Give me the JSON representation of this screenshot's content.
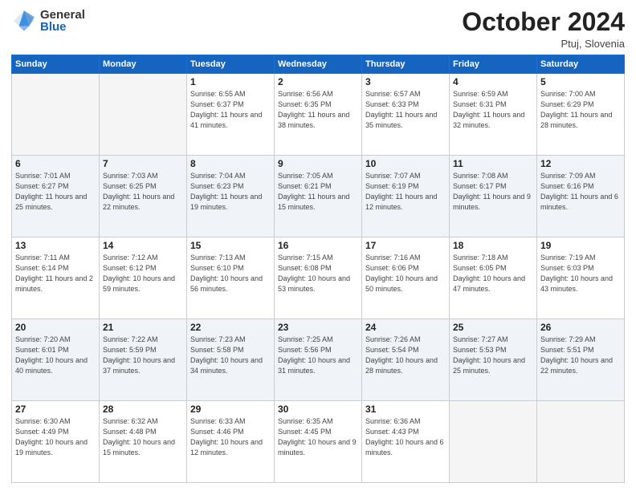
{
  "header": {
    "logo": {
      "general": "General",
      "blue": "Blue"
    },
    "title": "October 2024",
    "location": "Ptuj, Slovenia"
  },
  "weekdays": [
    "Sunday",
    "Monday",
    "Tuesday",
    "Wednesday",
    "Thursday",
    "Friday",
    "Saturday"
  ],
  "weeks": [
    [
      {
        "day": null,
        "info": null
      },
      {
        "day": null,
        "info": null
      },
      {
        "day": "1",
        "info": "Sunrise: 6:55 AM\nSunset: 6:37 PM\nDaylight: 11 hours and 41 minutes."
      },
      {
        "day": "2",
        "info": "Sunrise: 6:56 AM\nSunset: 6:35 PM\nDaylight: 11 hours and 38 minutes."
      },
      {
        "day": "3",
        "info": "Sunrise: 6:57 AM\nSunset: 6:33 PM\nDaylight: 11 hours and 35 minutes."
      },
      {
        "day": "4",
        "info": "Sunrise: 6:59 AM\nSunset: 6:31 PM\nDaylight: 11 hours and 32 minutes."
      },
      {
        "day": "5",
        "info": "Sunrise: 7:00 AM\nSunset: 6:29 PM\nDaylight: 11 hours and 28 minutes."
      }
    ],
    [
      {
        "day": "6",
        "info": "Sunrise: 7:01 AM\nSunset: 6:27 PM\nDaylight: 11 hours and 25 minutes."
      },
      {
        "day": "7",
        "info": "Sunrise: 7:03 AM\nSunset: 6:25 PM\nDaylight: 11 hours and 22 minutes."
      },
      {
        "day": "8",
        "info": "Sunrise: 7:04 AM\nSunset: 6:23 PM\nDaylight: 11 hours and 19 minutes."
      },
      {
        "day": "9",
        "info": "Sunrise: 7:05 AM\nSunset: 6:21 PM\nDaylight: 11 hours and 15 minutes."
      },
      {
        "day": "10",
        "info": "Sunrise: 7:07 AM\nSunset: 6:19 PM\nDaylight: 11 hours and 12 minutes."
      },
      {
        "day": "11",
        "info": "Sunrise: 7:08 AM\nSunset: 6:17 PM\nDaylight: 11 hours and 9 minutes."
      },
      {
        "day": "12",
        "info": "Sunrise: 7:09 AM\nSunset: 6:16 PM\nDaylight: 11 hours and 6 minutes."
      }
    ],
    [
      {
        "day": "13",
        "info": "Sunrise: 7:11 AM\nSunset: 6:14 PM\nDaylight: 11 hours and 2 minutes."
      },
      {
        "day": "14",
        "info": "Sunrise: 7:12 AM\nSunset: 6:12 PM\nDaylight: 10 hours and 59 minutes."
      },
      {
        "day": "15",
        "info": "Sunrise: 7:13 AM\nSunset: 6:10 PM\nDaylight: 10 hours and 56 minutes."
      },
      {
        "day": "16",
        "info": "Sunrise: 7:15 AM\nSunset: 6:08 PM\nDaylight: 10 hours and 53 minutes."
      },
      {
        "day": "17",
        "info": "Sunrise: 7:16 AM\nSunset: 6:06 PM\nDaylight: 10 hours and 50 minutes."
      },
      {
        "day": "18",
        "info": "Sunrise: 7:18 AM\nSunset: 6:05 PM\nDaylight: 10 hours and 47 minutes."
      },
      {
        "day": "19",
        "info": "Sunrise: 7:19 AM\nSunset: 6:03 PM\nDaylight: 10 hours and 43 minutes."
      }
    ],
    [
      {
        "day": "20",
        "info": "Sunrise: 7:20 AM\nSunset: 6:01 PM\nDaylight: 10 hours and 40 minutes."
      },
      {
        "day": "21",
        "info": "Sunrise: 7:22 AM\nSunset: 5:59 PM\nDaylight: 10 hours and 37 minutes."
      },
      {
        "day": "22",
        "info": "Sunrise: 7:23 AM\nSunset: 5:58 PM\nDaylight: 10 hours and 34 minutes."
      },
      {
        "day": "23",
        "info": "Sunrise: 7:25 AM\nSunset: 5:56 PM\nDaylight: 10 hours and 31 minutes."
      },
      {
        "day": "24",
        "info": "Sunrise: 7:26 AM\nSunset: 5:54 PM\nDaylight: 10 hours and 28 minutes."
      },
      {
        "day": "25",
        "info": "Sunrise: 7:27 AM\nSunset: 5:53 PM\nDaylight: 10 hours and 25 minutes."
      },
      {
        "day": "26",
        "info": "Sunrise: 7:29 AM\nSunset: 5:51 PM\nDaylight: 10 hours and 22 minutes."
      }
    ],
    [
      {
        "day": "27",
        "info": "Sunrise: 6:30 AM\nSunset: 4:49 PM\nDaylight: 10 hours and 19 minutes."
      },
      {
        "day": "28",
        "info": "Sunrise: 6:32 AM\nSunset: 4:48 PM\nDaylight: 10 hours and 15 minutes."
      },
      {
        "day": "29",
        "info": "Sunrise: 6:33 AM\nSunset: 4:46 PM\nDaylight: 10 hours and 12 minutes."
      },
      {
        "day": "30",
        "info": "Sunrise: 6:35 AM\nSunset: 4:45 PM\nDaylight: 10 hours and 9 minutes."
      },
      {
        "day": "31",
        "info": "Sunrise: 6:36 AM\nSunset: 4:43 PM\nDaylight: 10 hours and 6 minutes."
      },
      {
        "day": null,
        "info": null
      },
      {
        "day": null,
        "info": null
      }
    ]
  ]
}
